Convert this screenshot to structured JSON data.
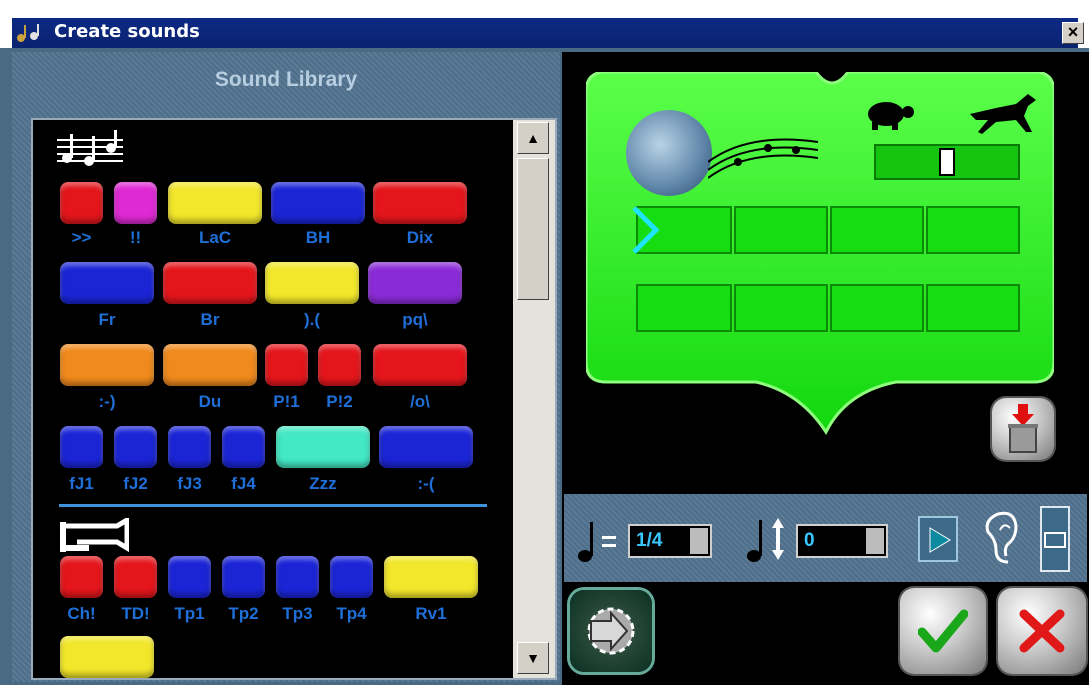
{
  "window": {
    "title": "Create sounds",
    "close_label": "×"
  },
  "library": {
    "title": "Sound Library",
    "sections": [
      {
        "icon": "music-notes-icon",
        "rows": [
          [
            {
              "label": ">>",
              "color": "#e4161c"
            },
            {
              "label": "!!",
              "color": "#df29d4"
            },
            {
              "label": "LaC",
              "color": "#f2e72b"
            },
            {
              "label": "BH",
              "color": "#1b25d6"
            },
            {
              "label": "Dix",
              "color": "#e4161c"
            }
          ],
          [
            {
              "label": "Fr",
              "color": "#1b25d6"
            },
            {
              "label": "Br",
              "color": "#e4161c"
            },
            {
              "label": ").(",
              "color": "#f2e72b"
            },
            {
              "label": "pq\\",
              "color": "#8a2bd8"
            }
          ],
          [
            {
              "label": ":-)",
              "color": "#f08a1c"
            },
            {
              "label": "Du",
              "color": "#f08a1c"
            },
            {
              "label": "P!1",
              "color": "#e4161c"
            },
            {
              "label": "P!2",
              "color": "#e4161c"
            },
            {
              "label": "/o\\",
              "color": "#e4161c"
            }
          ],
          [
            {
              "label": "fJ1",
              "color": "#1b25d6"
            },
            {
              "label": "fJ2",
              "color": "#1b25d6"
            },
            {
              "label": "fJ3",
              "color": "#1b25d6"
            },
            {
              "label": "fJ4",
              "color": "#1b25d6"
            },
            {
              "label": "Zzz",
              "color": "#43e8c4"
            },
            {
              "label": ":-(",
              "color": "#1b25d6"
            }
          ]
        ]
      },
      {
        "icon": "horn-icon",
        "rows": [
          [
            {
              "label": "Ch!",
              "color": "#e4161c"
            },
            {
              "label": "TD!",
              "color": "#e4161c"
            },
            {
              "label": "Tp1",
              "color": "#1b25d6"
            },
            {
              "label": "Tp2",
              "color": "#1b25d6"
            },
            {
              "label": "Tp3",
              "color": "#1b25d6"
            },
            {
              "label": "Tp4",
              "color": "#1b25d6"
            },
            {
              "label": "Rv1",
              "color": "#f2e72b"
            }
          ],
          [
            {
              "label": "",
              "color": "#f2e72b"
            }
          ]
        ]
      }
    ]
  },
  "composer": {
    "speed_slow_icon": "turtle-icon",
    "speed_fast_icon": "horse-icon",
    "speed_level": 0.5,
    "rows": 2,
    "slots_per_row": 4
  },
  "controls": {
    "note_length_value": "1/4",
    "pitch_value": "0",
    "play_icon": "play-icon",
    "listen_icon": "ear-icon"
  },
  "colors": {
    "green": "#19ea14",
    "panel": "#4d6d88",
    "label": "#1f6fd8"
  }
}
